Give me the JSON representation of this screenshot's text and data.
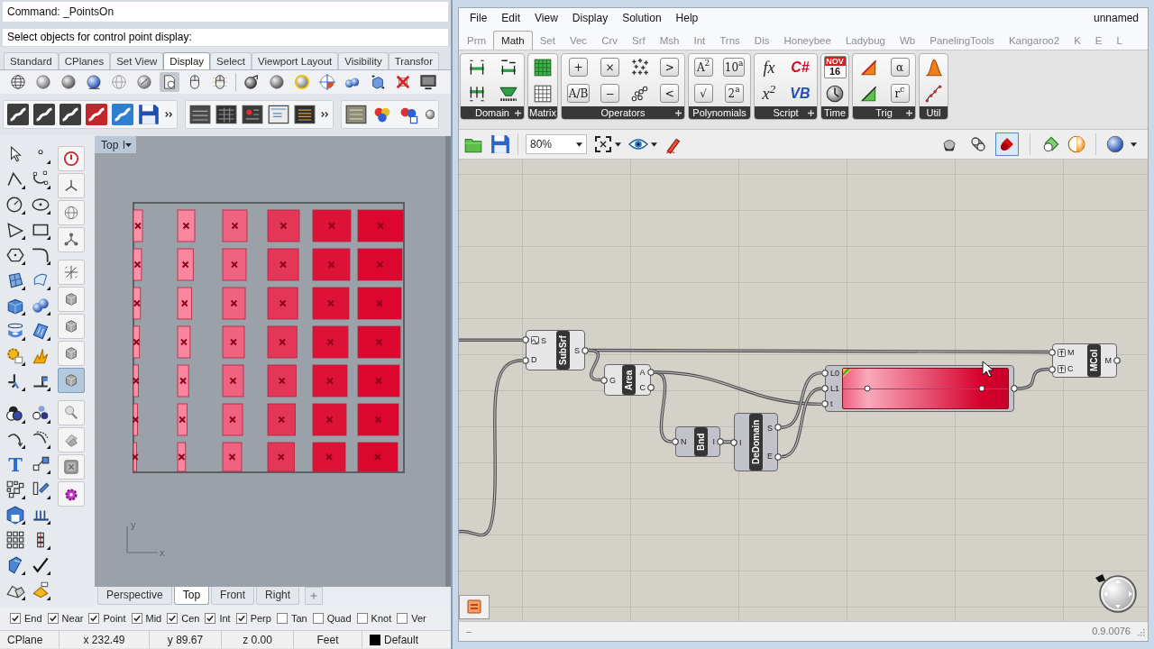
{
  "rhino": {
    "command_history": "Command: _PointsOn",
    "command_prompt": "Select objects for control point display:",
    "toolbar_tabs": [
      {
        "label": "Standard",
        "selected": false
      },
      {
        "label": "CPlanes",
        "selected": false
      },
      {
        "label": "Set View",
        "selected": false
      },
      {
        "label": "Display",
        "selected": true
      },
      {
        "label": "Select",
        "selected": false
      },
      {
        "label": "Viewport Layout",
        "selected": false
      },
      {
        "label": "Visibility",
        "selected": false
      },
      {
        "label": "Transfor",
        "selected": false
      }
    ],
    "display_tools": [
      {
        "selected": false
      },
      {
        "selected": false
      },
      {
        "selected": false
      },
      {
        "selected": false
      },
      {
        "selected": false
      },
      {
        "selected": false
      },
      {
        "selected": true
      },
      {
        "selected": false
      },
      {
        "selected": false
      },
      {
        "selected": false
      },
      {
        "selected": false
      },
      {
        "selected": false
      },
      {
        "selected": false
      },
      {
        "selected": false
      },
      {
        "selected": false
      },
      {
        "selected": false
      },
      {
        "selected": false
      }
    ],
    "text_tool": "T",
    "side_tools": [
      {
        "selected": false
      },
      {
        "selected": false
      },
      {
        "selected": false
      },
      {
        "selected": false
      },
      {
        "selected": false
      },
      {
        "selected": false
      },
      {
        "selected": false
      },
      {
        "selected": false
      },
      {
        "selected": true
      },
      {
        "selected": false
      },
      {
        "selected": false
      },
      {
        "selected": false
      },
      {
        "selected": false
      }
    ],
    "viewport": {
      "title": "Top",
      "surface_columns": [
        {
          "color": "#f993aa"
        },
        {
          "color": "#f7869e"
        },
        {
          "color": "#ef6381"
        },
        {
          "color": "#e43656"
        },
        {
          "color": "#dd1236"
        },
        {
          "color": "#dc062e"
        }
      ],
      "axis_y": "y",
      "axis_x": "x"
    },
    "viewport_tabs": [
      {
        "label": "Perspective",
        "selected": false
      },
      {
        "label": "Top",
        "selected": true
      },
      {
        "label": "Front",
        "selected": false
      },
      {
        "label": "Right",
        "selected": false
      }
    ],
    "osnaps": [
      {
        "label": "End",
        "checked": true
      },
      {
        "label": "Near",
        "checked": true
      },
      {
        "label": "Point",
        "checked": true
      },
      {
        "label": "Mid",
        "checked": true
      },
      {
        "label": "Cen",
        "checked": true
      },
      {
        "label": "Int",
        "checked": true
      },
      {
        "label": "Perp",
        "checked": true
      },
      {
        "label": "Tan",
        "checked": false
      },
      {
        "label": "Quad",
        "checked": false
      },
      {
        "label": "Knot",
        "checked": false
      },
      {
        "label": "Ver",
        "checked": false
      }
    ],
    "status_bar": {
      "cplane": "CPlane",
      "x": "x 232.49",
      "y": "y 89.67",
      "z": "z 0.00",
      "units": "Feet",
      "layer": "Default"
    }
  },
  "grasshopper": {
    "menu": [
      "File",
      "Edit",
      "View",
      "Display",
      "Solution",
      "Help"
    ],
    "document": "unnamed",
    "tabs": [
      {
        "label": "Prm",
        "selected": false
      },
      {
        "label": "Math",
        "selected": true
      },
      {
        "label": "Set",
        "selected": false
      },
      {
        "label": "Vec",
        "selected": false
      },
      {
        "label": "Crv",
        "selected": false
      },
      {
        "label": "Srf",
        "selected": false
      },
      {
        "label": "Msh",
        "selected": false
      },
      {
        "label": "Int",
        "selected": false
      },
      {
        "label": "Trns",
        "selected": false
      },
      {
        "label": "Dis",
        "selected": false
      },
      {
        "label": "Honeybee",
        "selected": false
      },
      {
        "label": "Ladybug",
        "selected": false
      },
      {
        "label": "Wb",
        "selected": false
      },
      {
        "label": "PanelingTools",
        "selected": false
      },
      {
        "label": "Kangaroo2",
        "selected": false
      },
      {
        "label": "K",
        "selected": false
      },
      {
        "label": "E",
        "selected": false
      },
      {
        "label": "L",
        "selected": false
      }
    ],
    "ribbon": [
      {
        "label": "Domain",
        "expandable": true,
        "buttons": [
          {
            "kind": "icon"
          },
          {
            "kind": "icon"
          },
          {
            "kind": "icon"
          },
          {
            "kind": "icon"
          }
        ]
      },
      {
        "label": "Matrix",
        "expandable": false,
        "buttons": [
          {
            "kind": "icon"
          },
          {
            "kind": "icon"
          }
        ]
      },
      {
        "label": "Operators",
        "expandable": true,
        "buttons": [
          {
            "kind": "boxed",
            "text": "+"
          },
          {
            "kind": "boxed",
            "text": "A/B"
          },
          {
            "kind": "boxed",
            "text": "×"
          },
          {
            "kind": "boxed",
            "text": "−"
          },
          {
            "kind": "icon"
          },
          {
            "kind": "icon"
          },
          {
            "kind": "boxed",
            "text": ">"
          },
          {
            "kind": "boxed",
            "text": "<"
          }
        ]
      },
      {
        "label": "Polynomials",
        "expandable": false,
        "buttons": [
          {
            "kind": "boxed",
            "text": "A$^{2}$"
          },
          {
            "kind": "boxed",
            "text": "√"
          },
          {
            "kind": "boxed",
            "text": "10$^{a}$"
          },
          {
            "kind": "boxed",
            "text": "2$^{a}$"
          }
        ]
      },
      {
        "label": "Script",
        "expandable": true,
        "buttons": [
          {
            "kind": "formula",
            "text": "fx"
          },
          {
            "kind": "formula",
            "text": "x$^{2}$"
          },
          {
            "kind": "code",
            "text": "C#",
            "color": "#c8102e"
          },
          {
            "kind": "code",
            "text": "VB",
            "color": "#1f4fb5"
          }
        ]
      },
      {
        "label": "Time",
        "expandable": false,
        "buttons": [
          {
            "kind": "calendar",
            "month": "NOV",
            "day": "16"
          },
          {
            "kind": "icon"
          }
        ]
      },
      {
        "label": "Trig",
        "expandable": true,
        "buttons": [
          {
            "kind": "icon"
          },
          {
            "kind": "icon"
          },
          {
            "kind": "boxed",
            "text": "α"
          },
          {
            "kind": "boxed",
            "text": "r$^{c}$"
          }
        ]
      },
      {
        "label": "Util",
        "expandable": false,
        "buttons": [
          {
            "kind": "icon"
          },
          {
            "kind": "icon"
          }
        ]
      }
    ],
    "zoom": "80%",
    "preview_modes": [
      {
        "selected": false
      },
      {
        "selected": false
      },
      {
        "selected": true
      }
    ],
    "canvas": {
      "nodes": [
        {
          "kind": "component",
          "label": "SubSrf",
          "preview": true,
          "inputs": [
            {
              "label": "S",
              "reparameterize": true
            },
            {
              "label": "D"
            }
          ],
          "outputs": [
            "S"
          ]
        },
        {
          "kind": "component",
          "label": "Area",
          "preview": true,
          "inputs": [
            {
              "label": "G"
            }
          ],
          "outputs": [
            "A",
            "C"
          ]
        },
        {
          "kind": "component",
          "label": "Bnd",
          "preview": false,
          "inputs": [
            {
              "label": "N"
            }
          ],
          "outputs": [
            "I"
          ]
        },
        {
          "kind": "component",
          "label": "DeDomain",
          "preview": false,
          "inputs": [
            {
              "label": "I"
            }
          ],
          "outputs": [
            "S",
            "E"
          ]
        },
        {
          "kind": "gradient",
          "preview": false,
          "inputs": [
            {
              "label": "L0"
            },
            {
              "label": "L1"
            },
            {
              "label": "t"
            }
          ],
          "grips": [
            {
              "level": 0.15
            },
            {
              "level": 0.84
            }
          ]
        },
        {
          "kind": "component",
          "label": "MCol",
          "preview": true,
          "inputs": [
            {
              "label": "M",
              "graft": true
            },
            {
              "label": "C",
              "graft": true
            }
          ],
          "outputs": [
            "M"
          ]
        }
      ]
    },
    "status": "–",
    "version": "0.9.0076"
  }
}
